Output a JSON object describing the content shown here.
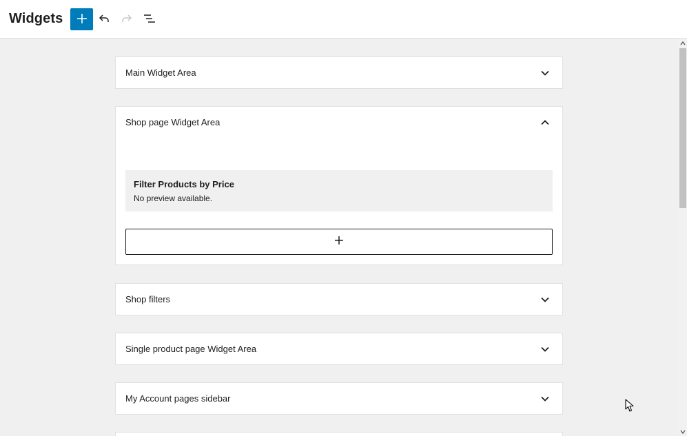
{
  "header": {
    "title": "Widgets",
    "add_block_icon": "plus-icon",
    "undo_icon": "undo-icon",
    "redo_icon": "redo-icon",
    "list_view_icon": "list-view-icon",
    "accent_color": "#007cba"
  },
  "widget_areas": [
    {
      "title": "Main Widget Area",
      "expanded": false
    },
    {
      "title": "Shop page Widget Area",
      "expanded": true,
      "widgets": [
        {
          "name": "Filter Products by Price",
          "preview": "No preview available."
        }
      ],
      "appender_icon": "plus-icon"
    },
    {
      "title": "Shop filters",
      "expanded": false
    },
    {
      "title": "Single product page Widget Area",
      "expanded": false
    },
    {
      "title": "My Account pages sidebar",
      "expanded": false
    }
  ]
}
